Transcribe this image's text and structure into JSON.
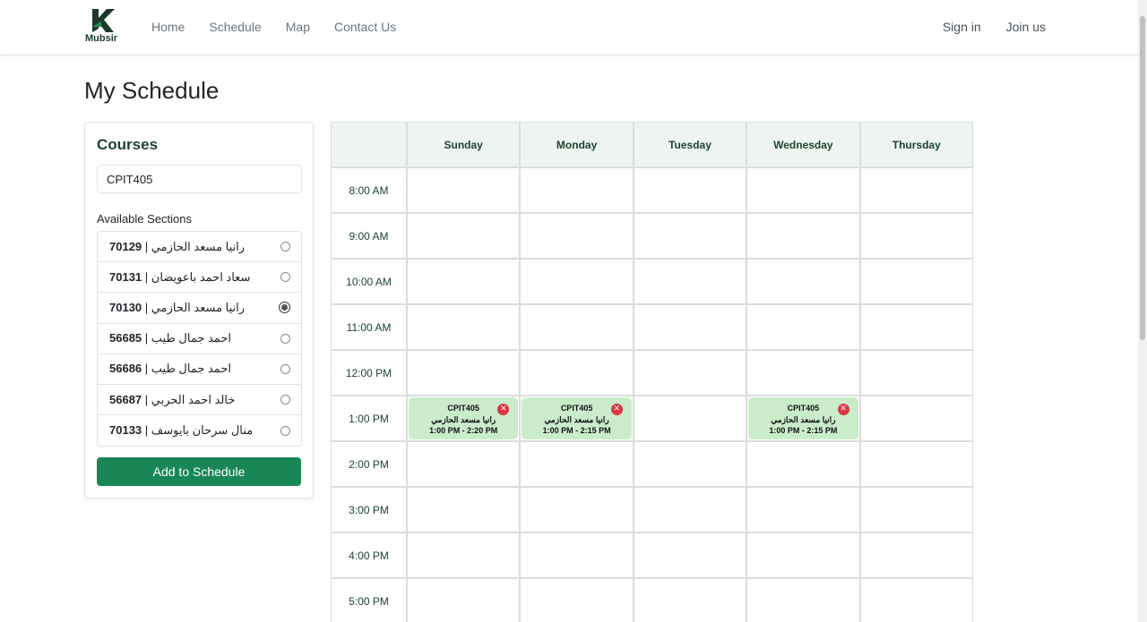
{
  "brand": {
    "name": "Mubsir"
  },
  "nav": {
    "links": [
      "Home",
      "Schedule",
      "Map",
      "Contact Us"
    ],
    "sign_in": "Sign in",
    "join": "Join us"
  },
  "page": {
    "title": "My Schedule"
  },
  "courses": {
    "title": "Courses",
    "input_value": "CPIT405",
    "sections_label": "Available Sections",
    "sections": [
      {
        "id": "70129",
        "instructor": "رانيا مسعد الحازمي",
        "selected": false
      },
      {
        "id": "70131",
        "instructor": "سعاد احمد باعويضان",
        "selected": false
      },
      {
        "id": "70130",
        "instructor": "رانيا مسعد الحازمي",
        "selected": true
      },
      {
        "id": "56685",
        "instructor": "احمد جمال طيب",
        "selected": false
      },
      {
        "id": "56686",
        "instructor": "احمد جمال طيب",
        "selected": false
      },
      {
        "id": "56687",
        "instructor": "خالد احمد الحربي",
        "selected": false
      },
      {
        "id": "70133",
        "instructor": "منال سرحان بايوسف",
        "selected": false
      }
    ],
    "add_button": "Add to Schedule"
  },
  "schedule": {
    "days": [
      "Sunday",
      "Monday",
      "Tuesday",
      "Wednesday",
      "Thursday"
    ],
    "times": [
      "8:00 AM",
      "9:00 AM",
      "10:00 AM",
      "11:00 AM",
      "12:00 PM",
      "1:00 PM",
      "2:00 PM",
      "3:00 PM",
      "4:00 PM",
      "5:00 PM"
    ],
    "events": [
      {
        "day": "Sunday",
        "time": "1:00 PM",
        "course": "CPIT405",
        "instructor": "رانيا مسعد الحازمي",
        "range": "1:00 PM - 2:20 PM"
      },
      {
        "day": "Monday",
        "time": "1:00 PM",
        "course": "CPIT405",
        "instructor": "رانيا مسعد الحازمي",
        "range": "1:00 PM - 2:15 PM"
      },
      {
        "day": "Wednesday",
        "time": "1:00 PM",
        "course": "CPIT405",
        "instructor": "رانيا مسعد الحازمي",
        "range": "1:00 PM - 2:15 PM"
      }
    ],
    "remove_symbol": "✕"
  },
  "colors": {
    "accent": "#198754",
    "event_bg": "#cbeccb",
    "remove": "#dc3545",
    "header_bg": "#eef5f0"
  }
}
